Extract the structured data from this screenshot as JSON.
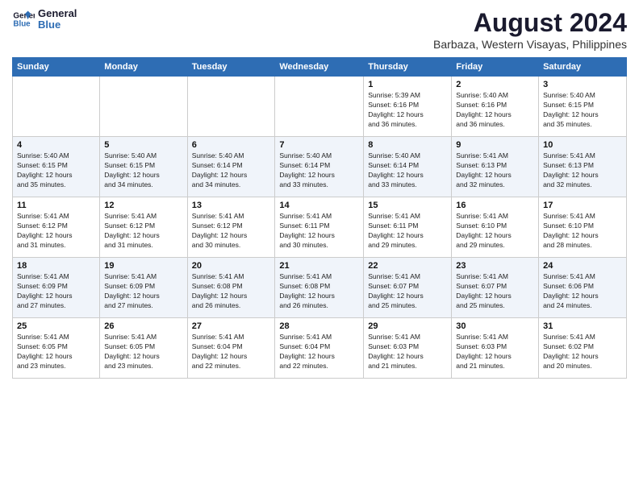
{
  "logo": {
    "line1": "General",
    "line2": "Blue"
  },
  "title": "August 2024",
  "location": "Barbaza, Western Visayas, Philippines",
  "weekdays": [
    "Sunday",
    "Monday",
    "Tuesday",
    "Wednesday",
    "Thursday",
    "Friday",
    "Saturday"
  ],
  "weeks": [
    [
      {
        "day": "",
        "info": ""
      },
      {
        "day": "",
        "info": ""
      },
      {
        "day": "",
        "info": ""
      },
      {
        "day": "",
        "info": ""
      },
      {
        "day": "1",
        "info": "Sunrise: 5:39 AM\nSunset: 6:16 PM\nDaylight: 12 hours\nand 36 minutes."
      },
      {
        "day": "2",
        "info": "Sunrise: 5:40 AM\nSunset: 6:16 PM\nDaylight: 12 hours\nand 36 minutes."
      },
      {
        "day": "3",
        "info": "Sunrise: 5:40 AM\nSunset: 6:15 PM\nDaylight: 12 hours\nand 35 minutes."
      }
    ],
    [
      {
        "day": "4",
        "info": "Sunrise: 5:40 AM\nSunset: 6:15 PM\nDaylight: 12 hours\nand 35 minutes."
      },
      {
        "day": "5",
        "info": "Sunrise: 5:40 AM\nSunset: 6:15 PM\nDaylight: 12 hours\nand 34 minutes."
      },
      {
        "day": "6",
        "info": "Sunrise: 5:40 AM\nSunset: 6:14 PM\nDaylight: 12 hours\nand 34 minutes."
      },
      {
        "day": "7",
        "info": "Sunrise: 5:40 AM\nSunset: 6:14 PM\nDaylight: 12 hours\nand 33 minutes."
      },
      {
        "day": "8",
        "info": "Sunrise: 5:40 AM\nSunset: 6:14 PM\nDaylight: 12 hours\nand 33 minutes."
      },
      {
        "day": "9",
        "info": "Sunrise: 5:41 AM\nSunset: 6:13 PM\nDaylight: 12 hours\nand 32 minutes."
      },
      {
        "day": "10",
        "info": "Sunrise: 5:41 AM\nSunset: 6:13 PM\nDaylight: 12 hours\nand 32 minutes."
      }
    ],
    [
      {
        "day": "11",
        "info": "Sunrise: 5:41 AM\nSunset: 6:12 PM\nDaylight: 12 hours\nand 31 minutes."
      },
      {
        "day": "12",
        "info": "Sunrise: 5:41 AM\nSunset: 6:12 PM\nDaylight: 12 hours\nand 31 minutes."
      },
      {
        "day": "13",
        "info": "Sunrise: 5:41 AM\nSunset: 6:12 PM\nDaylight: 12 hours\nand 30 minutes."
      },
      {
        "day": "14",
        "info": "Sunrise: 5:41 AM\nSunset: 6:11 PM\nDaylight: 12 hours\nand 30 minutes."
      },
      {
        "day": "15",
        "info": "Sunrise: 5:41 AM\nSunset: 6:11 PM\nDaylight: 12 hours\nand 29 minutes."
      },
      {
        "day": "16",
        "info": "Sunrise: 5:41 AM\nSunset: 6:10 PM\nDaylight: 12 hours\nand 29 minutes."
      },
      {
        "day": "17",
        "info": "Sunrise: 5:41 AM\nSunset: 6:10 PM\nDaylight: 12 hours\nand 28 minutes."
      }
    ],
    [
      {
        "day": "18",
        "info": "Sunrise: 5:41 AM\nSunset: 6:09 PM\nDaylight: 12 hours\nand 27 minutes."
      },
      {
        "day": "19",
        "info": "Sunrise: 5:41 AM\nSunset: 6:09 PM\nDaylight: 12 hours\nand 27 minutes."
      },
      {
        "day": "20",
        "info": "Sunrise: 5:41 AM\nSunset: 6:08 PM\nDaylight: 12 hours\nand 26 minutes."
      },
      {
        "day": "21",
        "info": "Sunrise: 5:41 AM\nSunset: 6:08 PM\nDaylight: 12 hours\nand 26 minutes."
      },
      {
        "day": "22",
        "info": "Sunrise: 5:41 AM\nSunset: 6:07 PM\nDaylight: 12 hours\nand 25 minutes."
      },
      {
        "day": "23",
        "info": "Sunrise: 5:41 AM\nSunset: 6:07 PM\nDaylight: 12 hours\nand 25 minutes."
      },
      {
        "day": "24",
        "info": "Sunrise: 5:41 AM\nSunset: 6:06 PM\nDaylight: 12 hours\nand 24 minutes."
      }
    ],
    [
      {
        "day": "25",
        "info": "Sunrise: 5:41 AM\nSunset: 6:05 PM\nDaylight: 12 hours\nand 23 minutes."
      },
      {
        "day": "26",
        "info": "Sunrise: 5:41 AM\nSunset: 6:05 PM\nDaylight: 12 hours\nand 23 minutes."
      },
      {
        "day": "27",
        "info": "Sunrise: 5:41 AM\nSunset: 6:04 PM\nDaylight: 12 hours\nand 22 minutes."
      },
      {
        "day": "28",
        "info": "Sunrise: 5:41 AM\nSunset: 6:04 PM\nDaylight: 12 hours\nand 22 minutes."
      },
      {
        "day": "29",
        "info": "Sunrise: 5:41 AM\nSunset: 6:03 PM\nDaylight: 12 hours\nand 21 minutes."
      },
      {
        "day": "30",
        "info": "Sunrise: 5:41 AM\nSunset: 6:03 PM\nDaylight: 12 hours\nand 21 minutes."
      },
      {
        "day": "31",
        "info": "Sunrise: 5:41 AM\nSunset: 6:02 PM\nDaylight: 12 hours\nand 20 minutes."
      }
    ]
  ]
}
